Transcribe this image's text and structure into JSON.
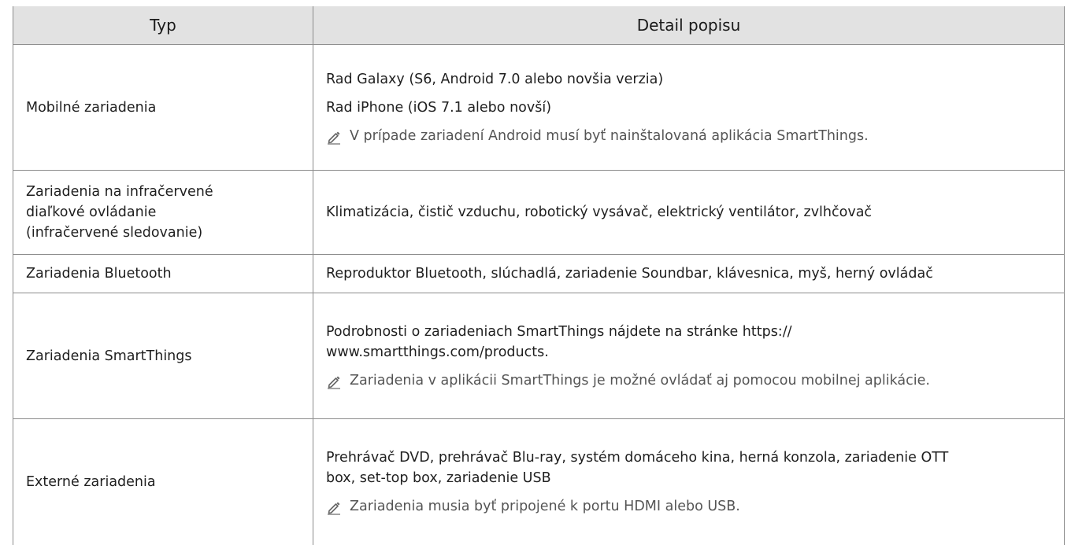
{
  "table": {
    "headers": [
      "Typ",
      "Detail popisu"
    ],
    "rows": [
      {
        "type": "Mobilné zariadenia",
        "details": [
          "Rad Galaxy (S6, Android 7.0 alebo novšia verzia)",
          "Rad iPhone (iOS 7.1 alebo novší)"
        ],
        "note": "V prípade zariadení Android musí byť nainštalovaná aplikácia SmartThings."
      },
      {
        "type_lines": [
          "Zariadenia na infračervené",
          "diaľkové ovládanie",
          "(infračervené sledovanie)"
        ],
        "details": [
          "Klimatizácia, čistič vzduchu, robotický vysávač, elektrický ventilátor, zvlhčovač"
        ]
      },
      {
        "type": "Zariadenia Bluetooth",
        "details": [
          "Reproduktor Bluetooth, slúchadlá, zariadenie Soundbar, klávesnica, myš, herný ovládač"
        ]
      },
      {
        "type": "Zariadenia SmartThings",
        "details_lines": [
          "Podrobnosti o zariadeniach SmartThings nájdete na stránke https://",
          "www.smartthings.com/products."
        ],
        "note": "Zariadenia v aplikácii SmartThings je možné ovládať aj pomocou mobilnej aplikácie."
      },
      {
        "type": "Externé zariadenia",
        "details_lines": [
          "Prehrávač DVD, prehrávač Blu-ray, systém domáceho kina, herná konzola, zariadenie OTT",
          "box, set-top box, zariadenie USB"
        ],
        "note": "Zariadenia musia byť pripojené k portu HDMI alebo USB."
      }
    ]
  },
  "icons": {
    "note": "pencil-icon"
  }
}
